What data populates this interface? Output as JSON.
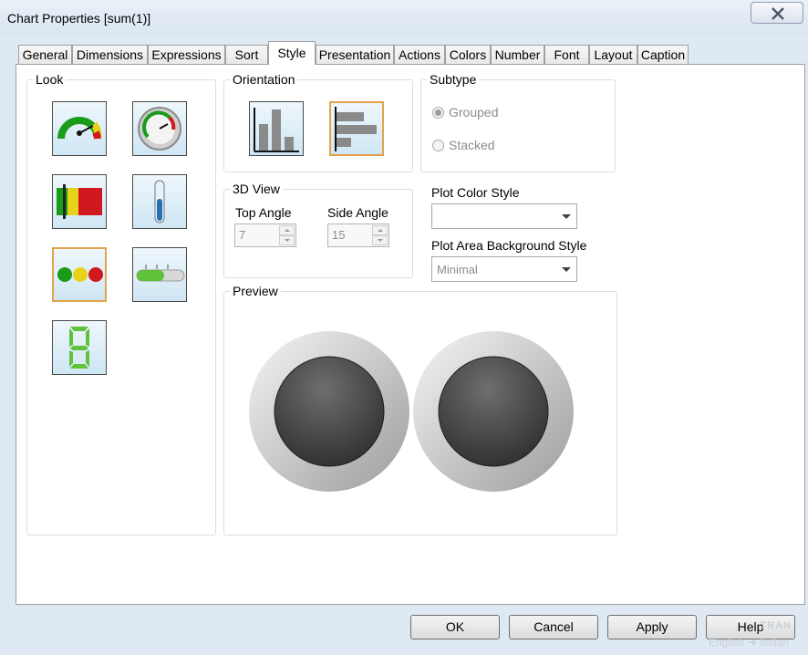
{
  "window": {
    "title": "Chart Properties [sum(1)]"
  },
  "tabs": [
    {
      "label": "General"
    },
    {
      "label": "Dimensions"
    },
    {
      "label": "Expressions"
    },
    {
      "label": "Sort"
    },
    {
      "label": "Style"
    },
    {
      "label": "Presentation"
    },
    {
      "label": "Actions"
    },
    {
      "label": "Colors"
    },
    {
      "label": "Number"
    },
    {
      "label": "Font"
    },
    {
      "label": "Layout"
    },
    {
      "label": "Caption"
    }
  ],
  "active_tab": "Style",
  "look": {
    "label": "Look",
    "options": [
      {
        "name": "gauge-speedometer-icon"
      },
      {
        "name": "gauge-circular-icon"
      },
      {
        "name": "traffic-bar-icon"
      },
      {
        "name": "thermometer-icon"
      },
      {
        "name": "traffic-light-icon",
        "selected": true
      },
      {
        "name": "linear-slider-gauge-icon"
      },
      {
        "name": "digital-led-icon"
      }
    ]
  },
  "orientation": {
    "label": "Orientation",
    "options": [
      {
        "name": "vertical-bars-icon"
      },
      {
        "name": "horizontal-bars-icon",
        "selected": true
      }
    ]
  },
  "subtype": {
    "label": "Subtype",
    "grouped": "Grouped",
    "stacked": "Stacked",
    "selected": "Grouped"
  },
  "view3d": {
    "label": "3D View",
    "top_angle_label": "Top Angle",
    "top_angle": "7",
    "side_angle_label": "Side Angle",
    "side_angle": "15"
  },
  "plot_color_style": {
    "label": "Plot Color Style",
    "value": ""
  },
  "plot_area_bg": {
    "label": "Plot Area Background Style",
    "value": "Minimal"
  },
  "preview": {
    "label": "Preview"
  },
  "buttons": {
    "ok": "OK",
    "cancel": "Cancel",
    "apply": "Apply",
    "help": "Help"
  },
  "watermark": {
    "brand": "TRAN",
    "from": "English",
    "to": "Italian"
  },
  "colors": {
    "accent_selected": "#e2a34a",
    "gauge_green": "#1a9b1a",
    "gauge_red": "#d0191e"
  }
}
